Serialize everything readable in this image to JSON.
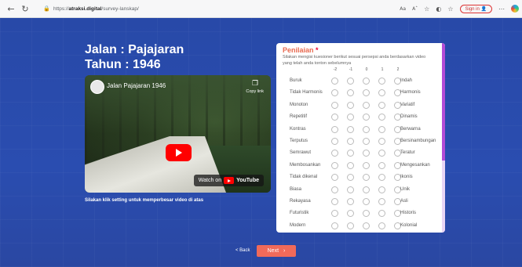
{
  "browser": {
    "url_prefix": "https://",
    "url_host": "atraksi.digital",
    "url_path": "/survey-lanskap/",
    "reader_icon": "Aa",
    "read_aloud_icon": "Aˆ",
    "sign_in": "Sign in"
  },
  "page": {
    "title_line1": "Jalan : Pajajaran",
    "title_line2": "Tahun : 1946",
    "caption": "Silakan klik setting untuk memperbesar video di atas"
  },
  "video": {
    "title": "Jalan Pajajaran 1946",
    "copy_link": "Copy link",
    "watch_on": "Watch on",
    "youtube": "YouTube"
  },
  "questionnaire": {
    "title": "Penilaian",
    "required_mark": "*",
    "description": "Silakan mengisi kuesioner berikut sesuai persepsi anda berdasarkan video yang telah anda tonton sebelumnya",
    "scale": [
      "-2",
      "-1",
      "0",
      "1",
      "2"
    ],
    "rows": [
      {
        "left": "Buruk",
        "right": "Indah"
      },
      {
        "left": "Tidak Harmonis",
        "right": "Harmonis"
      },
      {
        "left": "Monoton",
        "right": "Variatif"
      },
      {
        "left": "Repetitif",
        "right": "Dinamis"
      },
      {
        "left": "Kontras",
        "right": "Berwarna"
      },
      {
        "left": "Terputus",
        "right": "Bersinambungan"
      },
      {
        "left": "Semrawut",
        "right": "Teratur"
      },
      {
        "left": "Membosankan",
        "right": "Mengesankan"
      },
      {
        "left": "Tidak dikenal",
        "right": "Ikonis"
      },
      {
        "left": "Biasa",
        "right": "Unik"
      },
      {
        "left": "Rekayasa",
        "right": "Asli"
      },
      {
        "left": "Futuristik",
        "right": "Historis"
      },
      {
        "left": "Modern",
        "right": "Kolonial"
      }
    ]
  },
  "nav": {
    "back": "< Back",
    "next": "Next",
    "next_arrow": "›"
  },
  "colors": {
    "background": "#2a4aa8",
    "accent": "#f06a5a",
    "scrollbar": "#b34cd6"
  }
}
